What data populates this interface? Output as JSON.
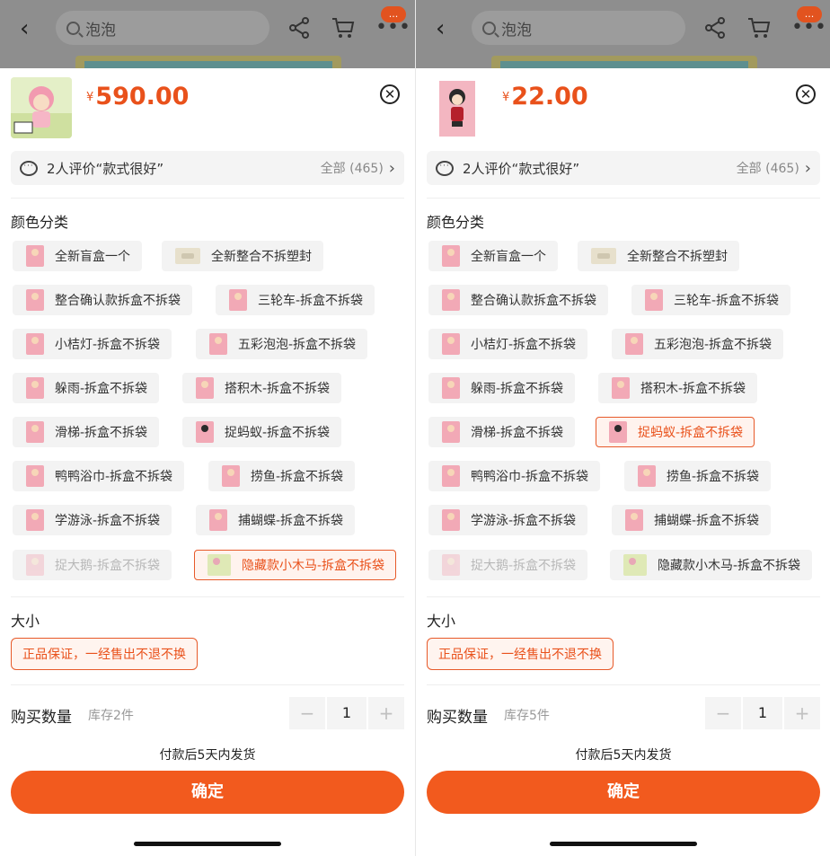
{
  "header": {
    "search_text": "泡泡",
    "badge_text": "..."
  },
  "accent_color": "#f25a1e",
  "panels": [
    {
      "price_currency": "¥",
      "price": "590.00",
      "review_text": "2人评价“款式很好”",
      "review_all": "全部 (465)",
      "section_color": "颜色分类",
      "options": [
        {
          "label": "全新盲盒一个",
          "state": "normal"
        },
        {
          "label": "全新整合不拆塑封",
          "state": "normal"
        },
        {
          "label": "整合确认款拆盒不拆袋",
          "state": "normal"
        },
        {
          "label": "三轮车-拆盒不拆袋",
          "state": "normal"
        },
        {
          "label": "小桔灯-拆盒不拆袋",
          "state": "normal"
        },
        {
          "label": "五彩泡泡-拆盒不拆袋",
          "state": "normal"
        },
        {
          "label": "躲雨-拆盒不拆袋",
          "state": "normal"
        },
        {
          "label": "搭积木-拆盒不拆袋",
          "state": "normal"
        },
        {
          "label": "滑梯-拆盒不拆袋",
          "state": "normal"
        },
        {
          "label": "捉蚂蚁-拆盒不拆袋",
          "state": "normal"
        },
        {
          "label": "鸭鸭浴巾-拆盒不拆袋",
          "state": "normal"
        },
        {
          "label": "捞鱼-拆盒不拆袋",
          "state": "normal"
        },
        {
          "label": "学游泳-拆盒不拆袋",
          "state": "normal"
        },
        {
          "label": "捕蝴蝶-拆盒不拆袋",
          "state": "normal"
        },
        {
          "label": "捉大鹅-拆盒不拆袋",
          "state": "disabled"
        },
        {
          "label": "隐藏款小木马-拆盒不拆袋",
          "state": "selected"
        }
      ],
      "section_size": "大小",
      "size_option": "正品保证，一经售出不退不换",
      "qty_label": "购买数量",
      "stock": "库存2件",
      "qty": "1",
      "minus": "−",
      "plus": "+",
      "ship_note": "付款后5天内发货",
      "confirm_label": "确定"
    },
    {
      "price_currency": "¥",
      "price": "22.00",
      "review_text": "2人评价“款式很好”",
      "review_all": "全部 (465)",
      "section_color": "颜色分类",
      "options": [
        {
          "label": "全新盲盒一个",
          "state": "normal"
        },
        {
          "label": "全新整合不拆塑封",
          "state": "normal"
        },
        {
          "label": "整合确认款拆盒不拆袋",
          "state": "normal"
        },
        {
          "label": "三轮车-拆盒不拆袋",
          "state": "normal"
        },
        {
          "label": "小桔灯-拆盒不拆袋",
          "state": "normal"
        },
        {
          "label": "五彩泡泡-拆盒不拆袋",
          "state": "normal"
        },
        {
          "label": "躲雨-拆盒不拆袋",
          "state": "normal"
        },
        {
          "label": "搭积木-拆盒不拆袋",
          "state": "normal"
        },
        {
          "label": "滑梯-拆盒不拆袋",
          "state": "normal"
        },
        {
          "label": "捉蚂蚁-拆盒不拆袋",
          "state": "selected"
        },
        {
          "label": "鸭鸭浴巾-拆盒不拆袋",
          "state": "normal"
        },
        {
          "label": "捞鱼-拆盒不拆袋",
          "state": "normal"
        },
        {
          "label": "学游泳-拆盒不拆袋",
          "state": "normal"
        },
        {
          "label": "捕蝴蝶-拆盒不拆袋",
          "state": "normal"
        },
        {
          "label": "捉大鹅-拆盒不拆袋",
          "state": "disabled"
        },
        {
          "label": "隐藏款小木马-拆盒不拆袋",
          "state": "normal"
        }
      ],
      "section_size": "大小",
      "size_option": "正品保证，一经售出不退不换",
      "qty_label": "购买数量",
      "stock": "库存5件",
      "qty": "1",
      "minus": "−",
      "plus": "+",
      "ship_note": "付款后5天内发货",
      "confirm_label": "确定"
    }
  ]
}
